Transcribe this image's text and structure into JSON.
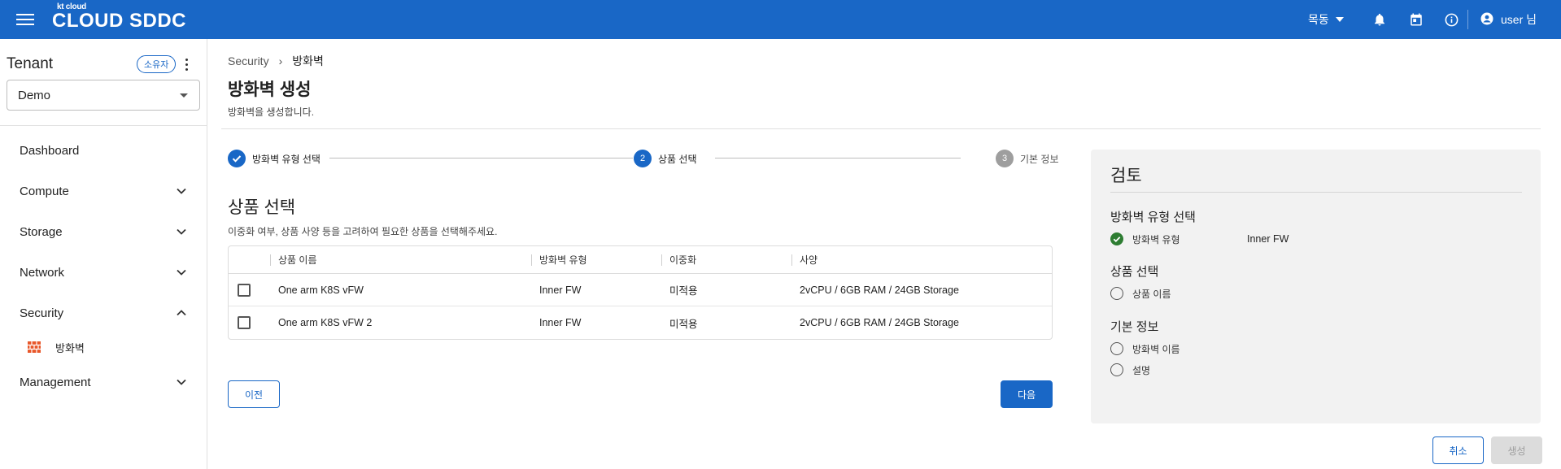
{
  "header": {
    "logo_small": "kt cloud",
    "logo_big": "CLOUD SDDC",
    "region": "목동",
    "user": "user 님",
    "icons": [
      "menu-icon",
      "bell-icon",
      "calendar-icon",
      "info-icon",
      "account-icon"
    ],
    "brand_color": "#1967c6"
  },
  "sidebar": {
    "tenant_title": "Tenant",
    "owner_badge": "소유자",
    "tenant_value": "Demo",
    "items": [
      {
        "label": "Dashboard"
      },
      {
        "label": "Compute"
      },
      {
        "label": "Storage"
      },
      {
        "label": "Network"
      },
      {
        "label": "Security"
      },
      {
        "label": "방화벽"
      },
      {
        "label": "Management"
      }
    ]
  },
  "breadcrumb": {
    "parent": "Security",
    "separator": "›",
    "current": "방화벽"
  },
  "page": {
    "title": "방화벽 생성",
    "desc": "방화벽을 생성합니다."
  },
  "stepper": {
    "steps": [
      {
        "num": "",
        "label": "방화벽 유형 선택",
        "state": "done"
      },
      {
        "num": "2",
        "label": "상품 선택",
        "state": "active"
      },
      {
        "num": "3",
        "label": "기본 정보",
        "state": "pending"
      }
    ]
  },
  "section": {
    "title": "상품 선택",
    "desc": "이중화 여부, 상품 사양 등을 고려하여 필요한 상품을 선택해주세요."
  },
  "table": {
    "headers": [
      "상품 이름",
      "방화벽 유형",
      "이중화",
      "사양"
    ],
    "rows": [
      {
        "name": "One arm K8S vFW",
        "type": "Inner FW",
        "ha": "미적용",
        "spec": "2vCPU / 6GB RAM / 24GB Storage",
        "checked": false
      },
      {
        "name": "One arm K8S vFW 2",
        "type": "Inner FW",
        "ha": "미적용",
        "spec": "2vCPU / 6GB RAM / 24GB Storage",
        "checked": false
      }
    ]
  },
  "buttons": {
    "prev": "이전",
    "next": "다음",
    "cancel": "취소",
    "create": "생성"
  },
  "review": {
    "title": "검토",
    "sections": [
      {
        "title": "방화벽 유형 선택",
        "items": [
          {
            "label": "방화벽 유형",
            "value": "Inner FW",
            "done": true
          }
        ]
      },
      {
        "title": "상품 선택",
        "items": [
          {
            "label": "상품 이름",
            "value": "",
            "done": false
          }
        ]
      },
      {
        "title": "기본 정보",
        "items": [
          {
            "label": "방화벽 이름",
            "value": "",
            "done": false
          },
          {
            "label": "설명",
            "value": "",
            "done": false
          }
        ]
      }
    ]
  }
}
